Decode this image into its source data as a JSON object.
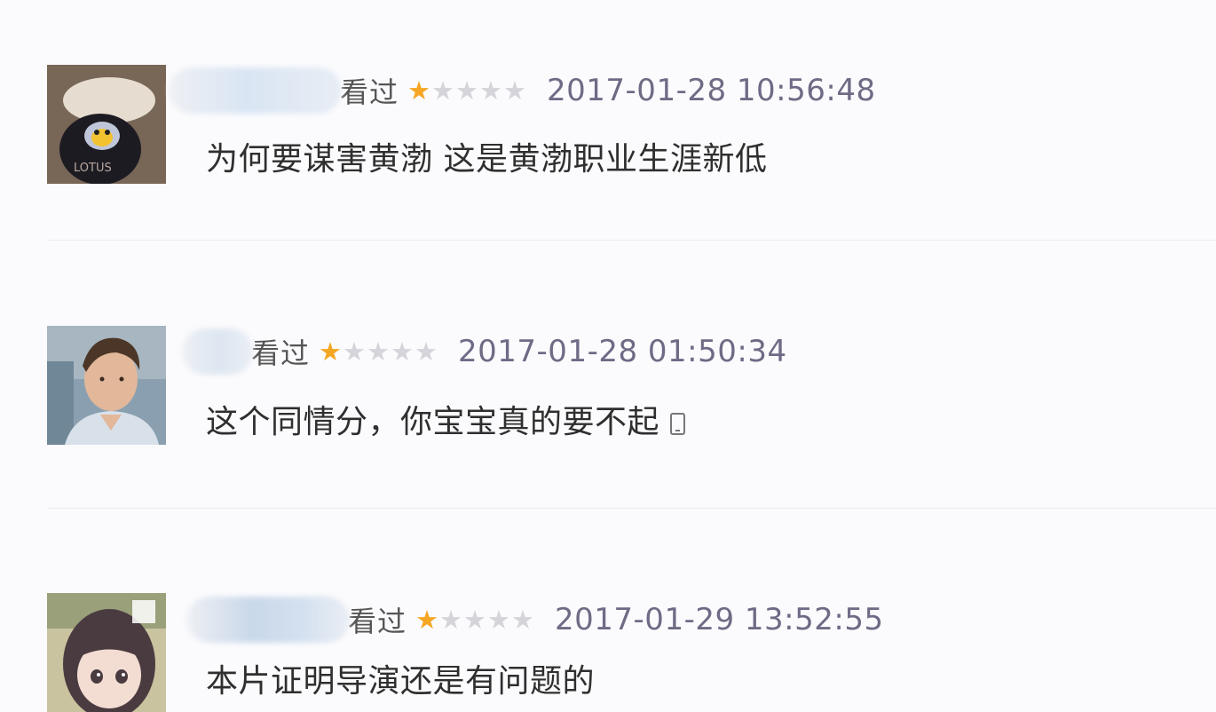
{
  "comments": [
    {
      "status": "看过",
      "rating": 1,
      "max_rating": 5,
      "time": "2017-01-28 10:56:48",
      "text": "为何要谋害黄渤 这是黄渤职业生涯新低"
    },
    {
      "status": "看过",
      "rating": 1,
      "max_rating": 5,
      "time": "2017-01-28 01:50:34",
      "text": "这个同情分，你宝宝真的要不起"
    },
    {
      "status": "看过",
      "rating": 1,
      "max_rating": 5,
      "time": "2017-01-29 13:52:55",
      "text": "本片证明导演还是有问题的"
    }
  ],
  "colors": {
    "star_on": "#f5a623",
    "star_off": "#d4d4da",
    "time": "#6f6a85",
    "background": "#fbfbfd"
  },
  "icons": [
    "mobile-phone-icon",
    "star-icon"
  ]
}
